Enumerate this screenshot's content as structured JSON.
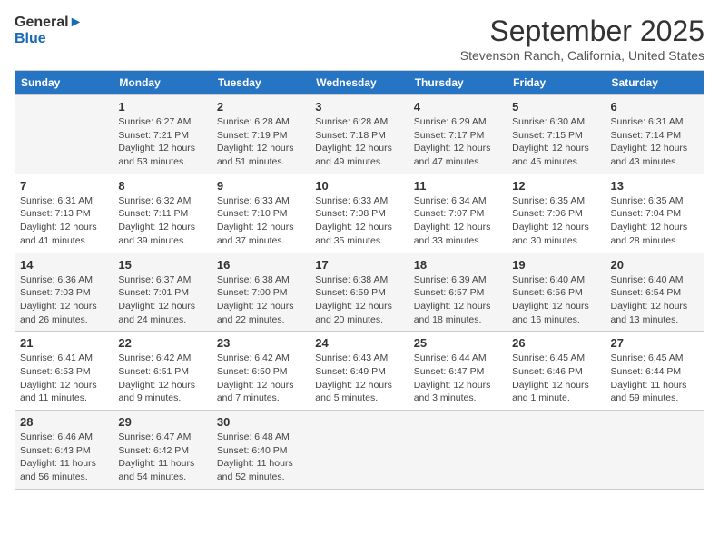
{
  "logo": {
    "line1": "General",
    "line2": "Blue"
  },
  "title": "September 2025",
  "location": "Stevenson Ranch, California, United States",
  "weekdays": [
    "Sunday",
    "Monday",
    "Tuesday",
    "Wednesday",
    "Thursday",
    "Friday",
    "Saturday"
  ],
  "weeks": [
    [
      {
        "day": "",
        "info": ""
      },
      {
        "day": "1",
        "info": "Sunrise: 6:27 AM\nSunset: 7:21 PM\nDaylight: 12 hours\nand 53 minutes."
      },
      {
        "day": "2",
        "info": "Sunrise: 6:28 AM\nSunset: 7:19 PM\nDaylight: 12 hours\nand 51 minutes."
      },
      {
        "day": "3",
        "info": "Sunrise: 6:28 AM\nSunset: 7:18 PM\nDaylight: 12 hours\nand 49 minutes."
      },
      {
        "day": "4",
        "info": "Sunrise: 6:29 AM\nSunset: 7:17 PM\nDaylight: 12 hours\nand 47 minutes."
      },
      {
        "day": "5",
        "info": "Sunrise: 6:30 AM\nSunset: 7:15 PM\nDaylight: 12 hours\nand 45 minutes."
      },
      {
        "day": "6",
        "info": "Sunrise: 6:31 AM\nSunset: 7:14 PM\nDaylight: 12 hours\nand 43 minutes."
      }
    ],
    [
      {
        "day": "7",
        "info": "Sunrise: 6:31 AM\nSunset: 7:13 PM\nDaylight: 12 hours\nand 41 minutes."
      },
      {
        "day": "8",
        "info": "Sunrise: 6:32 AM\nSunset: 7:11 PM\nDaylight: 12 hours\nand 39 minutes."
      },
      {
        "day": "9",
        "info": "Sunrise: 6:33 AM\nSunset: 7:10 PM\nDaylight: 12 hours\nand 37 minutes."
      },
      {
        "day": "10",
        "info": "Sunrise: 6:33 AM\nSunset: 7:08 PM\nDaylight: 12 hours\nand 35 minutes."
      },
      {
        "day": "11",
        "info": "Sunrise: 6:34 AM\nSunset: 7:07 PM\nDaylight: 12 hours\nand 33 minutes."
      },
      {
        "day": "12",
        "info": "Sunrise: 6:35 AM\nSunset: 7:06 PM\nDaylight: 12 hours\nand 30 minutes."
      },
      {
        "day": "13",
        "info": "Sunrise: 6:35 AM\nSunset: 7:04 PM\nDaylight: 12 hours\nand 28 minutes."
      }
    ],
    [
      {
        "day": "14",
        "info": "Sunrise: 6:36 AM\nSunset: 7:03 PM\nDaylight: 12 hours\nand 26 minutes."
      },
      {
        "day": "15",
        "info": "Sunrise: 6:37 AM\nSunset: 7:01 PM\nDaylight: 12 hours\nand 24 minutes."
      },
      {
        "day": "16",
        "info": "Sunrise: 6:38 AM\nSunset: 7:00 PM\nDaylight: 12 hours\nand 22 minutes."
      },
      {
        "day": "17",
        "info": "Sunrise: 6:38 AM\nSunset: 6:59 PM\nDaylight: 12 hours\nand 20 minutes."
      },
      {
        "day": "18",
        "info": "Sunrise: 6:39 AM\nSunset: 6:57 PM\nDaylight: 12 hours\nand 18 minutes."
      },
      {
        "day": "19",
        "info": "Sunrise: 6:40 AM\nSunset: 6:56 PM\nDaylight: 12 hours\nand 16 minutes."
      },
      {
        "day": "20",
        "info": "Sunrise: 6:40 AM\nSunset: 6:54 PM\nDaylight: 12 hours\nand 13 minutes."
      }
    ],
    [
      {
        "day": "21",
        "info": "Sunrise: 6:41 AM\nSunset: 6:53 PM\nDaylight: 12 hours\nand 11 minutes."
      },
      {
        "day": "22",
        "info": "Sunrise: 6:42 AM\nSunset: 6:51 PM\nDaylight: 12 hours\nand 9 minutes."
      },
      {
        "day": "23",
        "info": "Sunrise: 6:42 AM\nSunset: 6:50 PM\nDaylight: 12 hours\nand 7 minutes."
      },
      {
        "day": "24",
        "info": "Sunrise: 6:43 AM\nSunset: 6:49 PM\nDaylight: 12 hours\nand 5 minutes."
      },
      {
        "day": "25",
        "info": "Sunrise: 6:44 AM\nSunset: 6:47 PM\nDaylight: 12 hours\nand 3 minutes."
      },
      {
        "day": "26",
        "info": "Sunrise: 6:45 AM\nSunset: 6:46 PM\nDaylight: 12 hours\nand 1 minute."
      },
      {
        "day": "27",
        "info": "Sunrise: 6:45 AM\nSunset: 6:44 PM\nDaylight: 11 hours\nand 59 minutes."
      }
    ],
    [
      {
        "day": "28",
        "info": "Sunrise: 6:46 AM\nSunset: 6:43 PM\nDaylight: 11 hours\nand 56 minutes."
      },
      {
        "day": "29",
        "info": "Sunrise: 6:47 AM\nSunset: 6:42 PM\nDaylight: 11 hours\nand 54 minutes."
      },
      {
        "day": "30",
        "info": "Sunrise: 6:48 AM\nSunset: 6:40 PM\nDaylight: 11 hours\nand 52 minutes."
      },
      {
        "day": "",
        "info": ""
      },
      {
        "day": "",
        "info": ""
      },
      {
        "day": "",
        "info": ""
      },
      {
        "day": "",
        "info": ""
      }
    ]
  ]
}
